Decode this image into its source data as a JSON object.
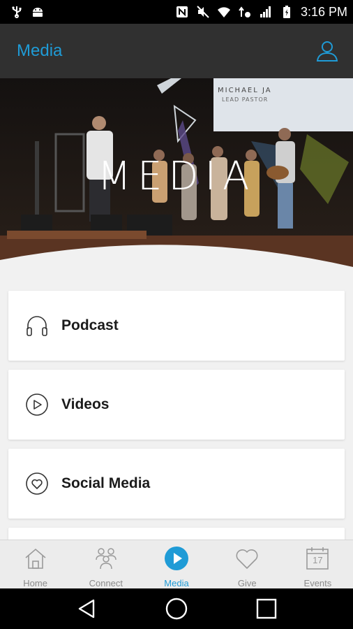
{
  "status_bar": {
    "time": "3:16 PM"
  },
  "app_bar": {
    "title": "Media"
  },
  "hero": {
    "title": "MEDIA",
    "screen_text_1": "MICHAEL JA",
    "screen_text_2": "LEAD PASTOR"
  },
  "list": {
    "items": [
      {
        "label": "Podcast",
        "icon": "headphones-icon"
      },
      {
        "label": "Videos",
        "icon": "play-circle-icon"
      },
      {
        "label": "Social Media",
        "icon": "heart-circle-icon"
      }
    ]
  },
  "tabs": [
    {
      "label": "Home",
      "icon": "home-icon",
      "active": false
    },
    {
      "label": "Connect",
      "icon": "people-icon",
      "active": false
    },
    {
      "label": "Media",
      "icon": "play-icon",
      "active": true
    },
    {
      "label": "Give",
      "icon": "heart-icon",
      "active": false
    },
    {
      "label": "Events",
      "icon": "calendar-icon",
      "active": false,
      "date_number": "17"
    }
  ],
  "colors": {
    "accent": "#1f9bd6",
    "app_bar": "#303030",
    "tab_inactive": "#8b8b8b"
  }
}
